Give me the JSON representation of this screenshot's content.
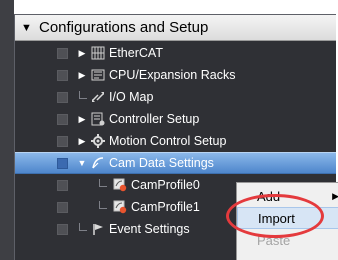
{
  "panel": {
    "title": "Configurations and Setup",
    "expand_glyph": "▼"
  },
  "tree": {
    "items": [
      {
        "label": "EtherCAT",
        "icon": "ethercat-icon",
        "expander": "▶"
      },
      {
        "label": "CPU/Expansion Racks",
        "icon": "cpu-racks-icon",
        "expander": "▶"
      },
      {
        "label": "I/O Map",
        "icon": "io-map-icon",
        "expander": ""
      },
      {
        "label": "Controller Setup",
        "icon": "controller-setup-icon",
        "expander": "▶"
      },
      {
        "label": "Motion Control Setup",
        "icon": "motion-control-icon",
        "expander": "▶"
      },
      {
        "label": "Cam Data Settings",
        "icon": "cam-data-icon",
        "expander": "▼",
        "selected": true
      },
      {
        "label": "CamProfile0",
        "icon": "cam-profile-icon",
        "expander": ""
      },
      {
        "label": "CamProfile1",
        "icon": "cam-profile-icon",
        "expander": ""
      },
      {
        "label": "Event Settings",
        "icon": "event-settings-icon",
        "expander": ""
      }
    ]
  },
  "context_menu": {
    "add_label": "Add",
    "add_arrow": "▶",
    "import_label": "Import",
    "paste_label": "Paste"
  },
  "colors": {
    "panel_bg": "#2f3035",
    "selection": "#4e86cc",
    "highlight_ellipse": "#e43a3d"
  }
}
